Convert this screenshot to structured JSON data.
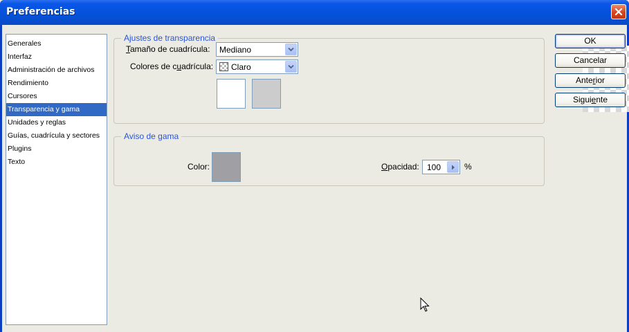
{
  "window": {
    "title": "Preferencias"
  },
  "sidebar": {
    "items": [
      {
        "label": "Generales"
      },
      {
        "label": "Interfaz"
      },
      {
        "label": "Administración de archivos"
      },
      {
        "label": "Rendimiento"
      },
      {
        "label": "Cursores"
      },
      {
        "label": "Transparencia y gama",
        "selected": true
      },
      {
        "label": "Unidades y reglas"
      },
      {
        "label": "Guías, cuadrícula y sectores"
      },
      {
        "label": "Plugins"
      },
      {
        "label": "Texto"
      }
    ]
  },
  "transparency": {
    "legend": "Ajustes de transparencia",
    "grid_size": {
      "label_u": "T",
      "label_rest": "amaño de cuadrícula:",
      "value": "Mediano"
    },
    "grid_colors": {
      "label_a": "Colores de c",
      "label_u": "u",
      "label_b": "adrícula:",
      "value": "Claro",
      "icon": "checkerboard-icon"
    },
    "swatch_colors": [
      "#ffffff",
      "#cccccc"
    ]
  },
  "gamut": {
    "legend": "Aviso de gama",
    "color_label": "Color:",
    "color_value": "#a0a0a4",
    "opacity": {
      "label_u": "O",
      "label_rest": "pacidad:",
      "value": "100",
      "unit": "%"
    }
  },
  "buttons": {
    "ok": "OK",
    "cancel": "Cancelar",
    "prev_a": "Ante",
    "prev_u": "r",
    "prev_b": "ior",
    "next_a": "Sigui",
    "next_u": "e",
    "next_b": "nte"
  },
  "colors": {
    "titlebar": "#0451d8",
    "selection": "#316ac5",
    "legend_text": "#2b55d6",
    "close": "#d8431c"
  }
}
